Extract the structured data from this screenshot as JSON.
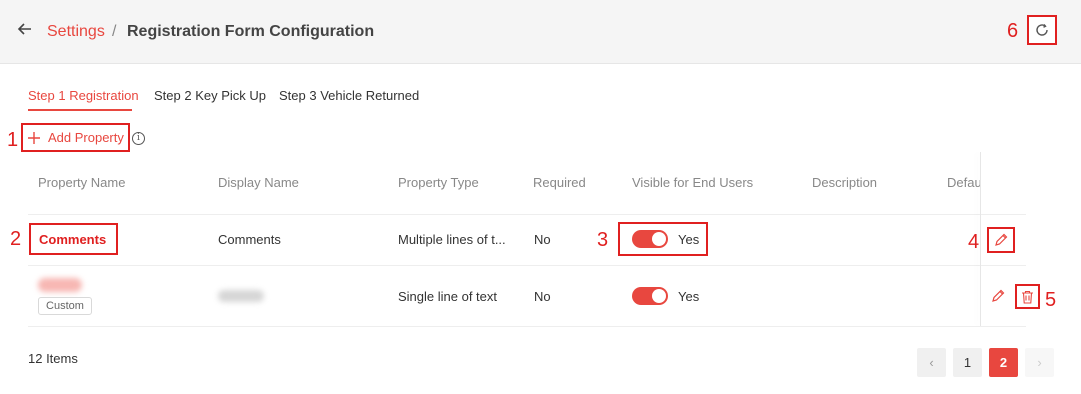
{
  "header": {
    "back_icon": "arrow-left-icon",
    "breadcrumb_link": "Settings",
    "breadcrumb_sep": "/",
    "title": "Registration Form Configuration",
    "refresh_icon": "refresh-icon"
  },
  "tabs": [
    {
      "label": "Step 1 Registration",
      "active": true
    },
    {
      "label": "Step 2 Key Pick Up",
      "active": false
    },
    {
      "label": "Step 3 Vehicle Returned",
      "active": false
    }
  ],
  "toolbar": {
    "add_icon": "plus-icon",
    "add_label": "Add Property",
    "info_icon": "info-icon",
    "info_glyph": "i"
  },
  "table": {
    "columns": [
      "Property Name",
      "Display Name",
      "Property Type",
      "Required",
      "Visible for End Users",
      "Description",
      "Defau"
    ],
    "rows": [
      {
        "property_name": "Comments",
        "display_name": "Comments",
        "property_type": "Multiple lines of t...",
        "required": "No",
        "visible": "Yes",
        "visible_on": true
      },
      {
        "property_name": "",
        "tag": "Custom",
        "display_name": "",
        "property_type": "Single line of text",
        "required": "No",
        "visible": "Yes",
        "visible_on": true
      }
    ]
  },
  "footer": {
    "items_count": "12 Items",
    "pagination": {
      "prev": "‹",
      "pages": [
        "1",
        "2"
      ],
      "current": "2",
      "next": "›"
    }
  },
  "annotations": [
    "1",
    "2",
    "3",
    "4",
    "5",
    "6"
  ],
  "colors": {
    "accent": "#e8473f",
    "annotation": "#e02020"
  }
}
